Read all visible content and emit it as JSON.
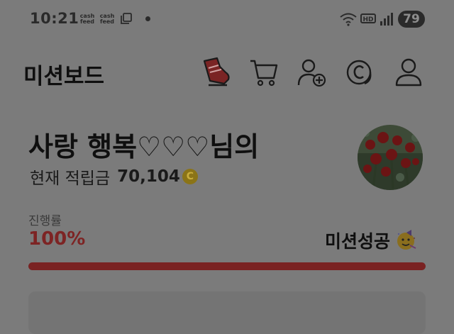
{
  "status_bar": {
    "time": "10:21",
    "badge_top": "cash",
    "badge_bottom": "feed",
    "hd": "HD",
    "battery": "79"
  },
  "header": {
    "title": "미션보드",
    "icons": [
      "shoe-icon",
      "cart-icon",
      "add-user-icon",
      "coin-c-icon",
      "user-icon"
    ]
  },
  "profile": {
    "greeting": "사랑 행복♡♡♡님의",
    "balance_label": "현재 적립금",
    "balance_value": "70,104",
    "coin_symbol": "C"
  },
  "progress": {
    "label": "진행률",
    "value_text": "100%",
    "fraction": 1.0,
    "status": "미션성공"
  },
  "colors": {
    "accent": "#7a2222",
    "overlay": "#7b7b7b"
  }
}
